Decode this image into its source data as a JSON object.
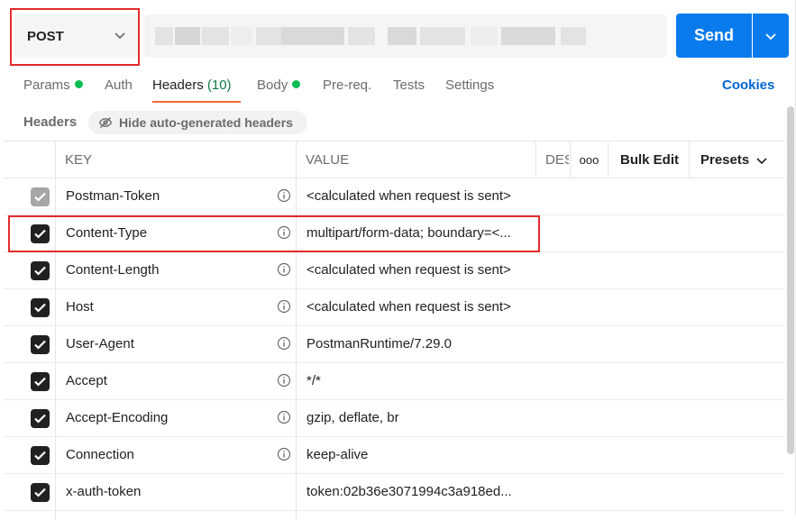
{
  "request": {
    "method": "POST",
    "send_label": "Send"
  },
  "tabs": [
    {
      "label": "Params",
      "dot": true
    },
    {
      "label": "Auth"
    },
    {
      "label": "Headers",
      "count": "(10)",
      "active": true
    },
    {
      "label": "Body",
      "dot": true
    },
    {
      "label": "Pre-req."
    },
    {
      "label": "Tests"
    },
    {
      "label": "Settings"
    }
  ],
  "cookies_label": "Cookies",
  "headers_section": {
    "label": "Headers",
    "hide_auto_label": "Hide auto-generated headers"
  },
  "table": {
    "columns": {
      "key": "KEY",
      "value": "VALUE",
      "description": "DESC"
    },
    "more_label": "ooo",
    "bulk_edit_label": "Bulk Edit",
    "presets_label": "Presets",
    "rows": [
      {
        "key": "Postman-Token",
        "value": "<calculated when request is sent>",
        "checked": true,
        "disabled": true,
        "info": true
      },
      {
        "key": "Content-Type",
        "value": "multipart/form-data; boundary=<...",
        "checked": true,
        "info": true
      },
      {
        "key": "Content-Length",
        "value": "<calculated when request is sent>",
        "checked": true,
        "info": true
      },
      {
        "key": "Host",
        "value": "<calculated when request is sent>",
        "checked": true,
        "info": true
      },
      {
        "key": "User-Agent",
        "value": "PostmanRuntime/7.29.0",
        "checked": true,
        "info": true
      },
      {
        "key": "Accept",
        "value": "*/*",
        "checked": true,
        "info": true
      },
      {
        "key": "Accept-Encoding",
        "value": "gzip, deflate, br",
        "checked": true,
        "info": true
      },
      {
        "key": "Connection",
        "value": "keep-alive",
        "checked": true,
        "info": true
      },
      {
        "key": "x-auth-token",
        "value": "token:02b36e3071994c3a918ed...",
        "checked": true,
        "info": false
      }
    ]
  },
  "colors": {
    "accent": "#097bed",
    "active_tab_underline": "#ff6c37",
    "highlight_box": "#e02b2b",
    "status_dot": "#0cbb52"
  }
}
